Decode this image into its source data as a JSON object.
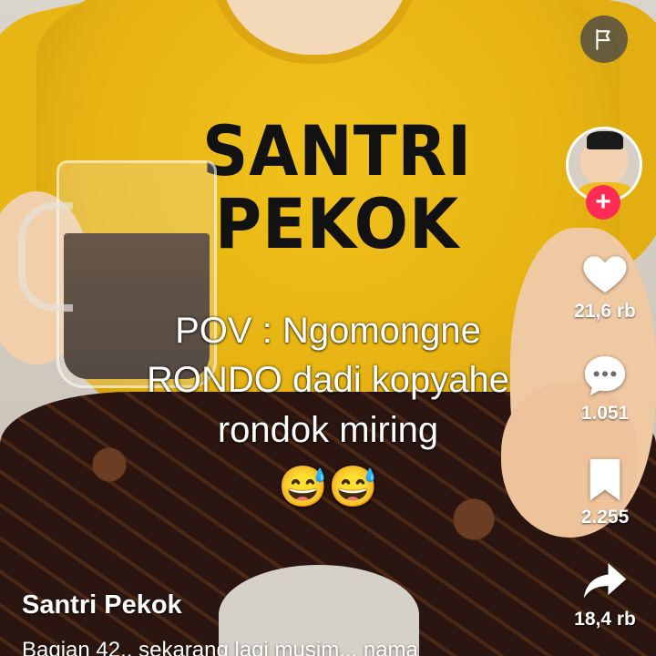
{
  "video": {
    "shirt_text_line1": "SANTRI",
    "shirt_text_line2": "PEKOK",
    "caption_line1": "POV : Ngomongne",
    "caption_line2": "RONDO dadi kopyahe",
    "caption_line3": "rondok miring",
    "caption_emoji": "😅😅"
  },
  "rail": {
    "flag_icon": "flag-icon",
    "avatar_icon": "profile-avatar",
    "follow_icon": "plus-icon",
    "follow_color": "#fe2c55",
    "like_count": "21,6 rb",
    "comment_count": "1.051",
    "save_count": "2.255",
    "share_count": "18,4 rb"
  },
  "info": {
    "author": "Santri Pekok",
    "description": "Bagian 42.. sekarang lagi musim... nama"
  }
}
